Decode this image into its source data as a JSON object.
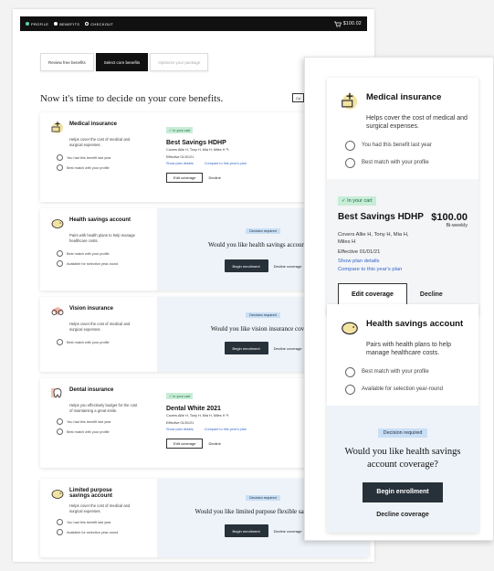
{
  "topbar": {
    "steps": [
      "PROFILE",
      "BENEFITS",
      "CHECKOUT"
    ],
    "cart_total": "$100.02"
  },
  "tabs": [
    "Review free benefits",
    "Select core benefits",
    "Optimize your package"
  ],
  "headline": "Now it's time to decide on your core benefits.",
  "mini_button": "Co",
  "cards": {
    "medical": {
      "title": "Medical insurance",
      "desc": "Helps cover the cost of medical and surgical expenses.",
      "features": [
        "You had this benefit last year",
        "Best match with your profile"
      ],
      "badge": "✓ In your cart",
      "plan": "Best Savings HDHP",
      "covers": "Covers Allie H, Tony H, Mia H, Miles H",
      "effective": "Effective 01/01/21",
      "link1": "Show plan details",
      "link2": "Compare to this year's plan",
      "edit": "Edit coverage",
      "decline": "Decline"
    },
    "hsa": {
      "title": "Health savings account",
      "desc": "Pairs with health plans to help manage healthcare costs.",
      "features": [
        "Best match with your profile",
        "Available for selection year-round"
      ],
      "badge": "Decision required",
      "question": "Would you like health savings account cov",
      "begin": "Begin enrollment",
      "decline": "Decline coverage"
    },
    "vision": {
      "title": "Vision insurance",
      "desc": "Helps cover the cost of medical and surgical expenses.",
      "features": [
        "Best match with your profile"
      ],
      "badge": "Decision required",
      "question": "Would you like vision insurance coverag",
      "begin": "Begin enrollment",
      "decline": "Decline coverage"
    },
    "dental": {
      "title": "Dental insurance",
      "desc": "Helps you effectively budget for the cost of maintaining a great smile.",
      "features": [
        "You had this benefit last year",
        "Best match with your profile"
      ],
      "badge": "✓ In your cart",
      "plan": "Dental White 2021",
      "covers": "Covers Allie H, Tony H, Mia H, Miles H",
      "effective": "Effective 01/01/21",
      "link1": "Show plan details",
      "link2": "Compare to this year's plan",
      "edit": "Edit coverage",
      "decline": "Decline"
    },
    "limited": {
      "title": "Limited purpose savings account",
      "desc": "Helps cover the cost of medical and surgical expenses.",
      "features": [
        "You had this benefit last year",
        "Available for selection year-round"
      ],
      "badge": "Decision required",
      "question": "Would you like limited purpose flexible savings acco",
      "begin": "Begin enrollment",
      "decline": "Decline coverage"
    }
  },
  "zoom": {
    "medical": {
      "title": "Medical insurance",
      "desc": "Helps cover the cost of medical and surgical expenses.",
      "features": [
        "You had this benefit last year",
        "Best match with your profile"
      ],
      "badge": "✓ In your cart",
      "plan": "Best Savings HDHP",
      "price": "$100.00",
      "freq": "Bi-weekly",
      "covers": "Covers Allie H, Tony H, Mia H, Miles H",
      "effective": "Effective 01/01/21",
      "link1": "Show plan details",
      "link2": "Compare to this year's plan",
      "edit": "Edit coverage",
      "decline": "Decline"
    },
    "hsa": {
      "title": "Health savings account",
      "desc": "Pairs with health plans to help manage healthcare costs.",
      "features": [
        "Best match with your profile",
        "Available for selection year-round"
      ],
      "badge": "Decision required",
      "question": "Would you like health savings account coverage?",
      "begin": "Begin enrollment",
      "decline": "Decline coverage"
    }
  },
  "colors": {
    "dark": "#111111",
    "button_dark": "#27313a",
    "green_badge": "#c7edd7",
    "blue_badge": "#c9dff5",
    "panel_blue": "#eef3f9",
    "link": "#3466c8"
  }
}
